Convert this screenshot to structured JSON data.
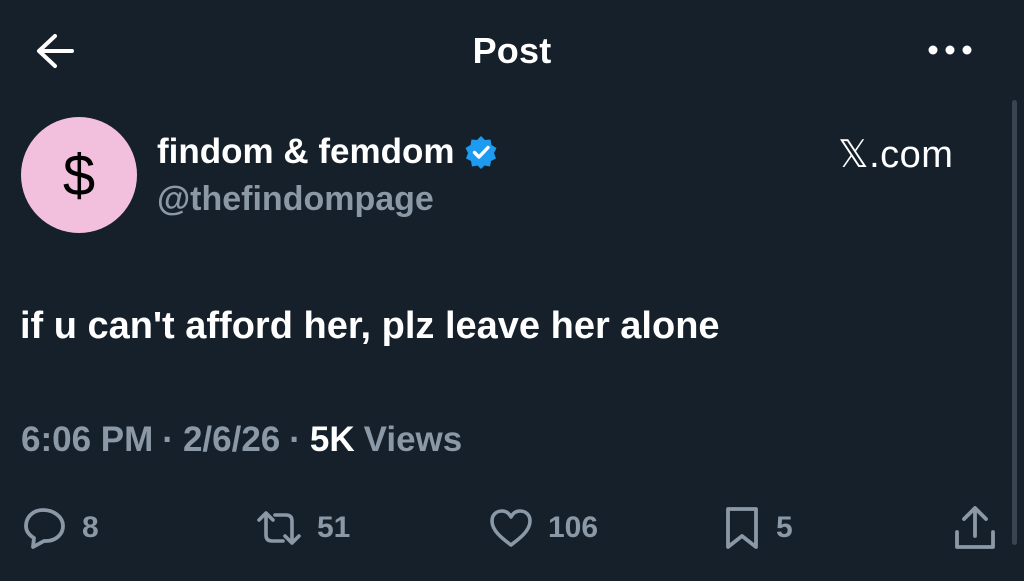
{
  "header": {
    "title": "Post",
    "back_icon": "arrow-left-icon",
    "more_icon": "more-horizontal-icon"
  },
  "author": {
    "avatar_symbol": "$",
    "avatar_color": "#f2c0dc",
    "display_name": "findom & femdom",
    "verified_icon": "verified-badge-icon",
    "verified_color": "#1d9bf0",
    "handle": "@thefindompage"
  },
  "brand": {
    "label": "𝕏.com"
  },
  "tweet": {
    "text": "if u can't afford her, plz leave her alone",
    "time": "6:06 PM",
    "separator": "·",
    "date": "2/6/26",
    "views_count": "5K",
    "views_label": "Views"
  },
  "actions": {
    "replies": {
      "icon": "reply-icon",
      "count": "8"
    },
    "reposts": {
      "icon": "repost-icon",
      "count": "51"
    },
    "likes": {
      "icon": "heart-icon",
      "count": "106"
    },
    "bookmarks": {
      "icon": "bookmark-icon",
      "count": "5"
    },
    "share": {
      "icon": "share-icon"
    }
  },
  "colors": {
    "background": "#15202b",
    "secondary_text": "#8b98a5",
    "primary_text": "#ffffff"
  }
}
